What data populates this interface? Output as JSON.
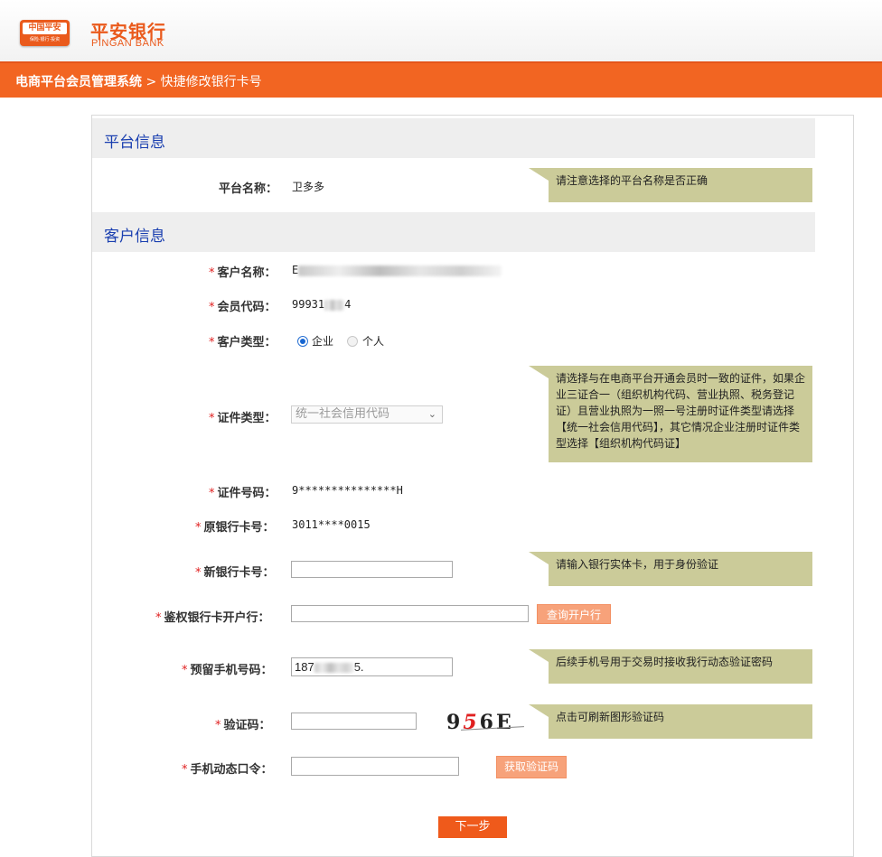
{
  "header": {
    "badge_text": "中国平安",
    "badge_sub": "保险·银行·投资",
    "brand_cn": "平安银行",
    "brand_en": "PINGAN BANK"
  },
  "nav": {
    "system": "电商平台会员管理系统",
    "separator": " > ",
    "page": "快捷修改银行卡号"
  },
  "platform_section": {
    "title": "平台信息",
    "name_label": "平台名称：",
    "name_value": "卫多多",
    "name_tip": "请注意选择的平台名称是否正确"
  },
  "customer_section": {
    "title": "客户信息",
    "required_mark": "*",
    "customer_name_label": "客户名称：",
    "customer_name_value": "E",
    "member_code_label": "会员代码：",
    "member_code_value": "99931",
    "member_code_tail": "4",
    "customer_type_label": "客户类型：",
    "type_enterprise": "企业",
    "type_personal": "个人",
    "cert_type_label": "证件类型：",
    "cert_type_selected": "统一社会信用代码",
    "cert_type_tip": "请选择与在电商平台开通会员时一致的证件，如果企业三证合一（组织机构代码、营业执照、税务登记证）且营业执照为一照一号注册时证件类型请选择【统一社会信用代码】，其它情况企业注册时证件类型选择【组织机构代码证】",
    "cert_no_label": "证件号码：",
    "cert_no_value": "9***************H",
    "old_card_label": "原银行卡号：",
    "old_card_value": "3011****0015",
    "new_card_label": "新银行卡号：",
    "new_card_value": "",
    "new_card_tip": "请输入银行实体卡，用于身份验证",
    "auth_bank_label": "鉴权银行卡开户行：",
    "auth_bank_value": "",
    "query_bank_button": "查询开户行",
    "phone_label": "预留手机号码：",
    "phone_value_prefix": "187",
    "phone_value_suffix": "5.",
    "phone_tip": "后续手机号用于交易时接收我行动态验证密码",
    "captcha_label": "验证码：",
    "captcha_value": "",
    "captcha_chars": [
      "9",
      "5",
      "6",
      "E"
    ],
    "captcha_tip": "点击可刷新图形验证码",
    "sms_label": "手机动态口令：",
    "sms_value": "",
    "get_code_button": "获取验证码",
    "next_button": "下一步"
  }
}
